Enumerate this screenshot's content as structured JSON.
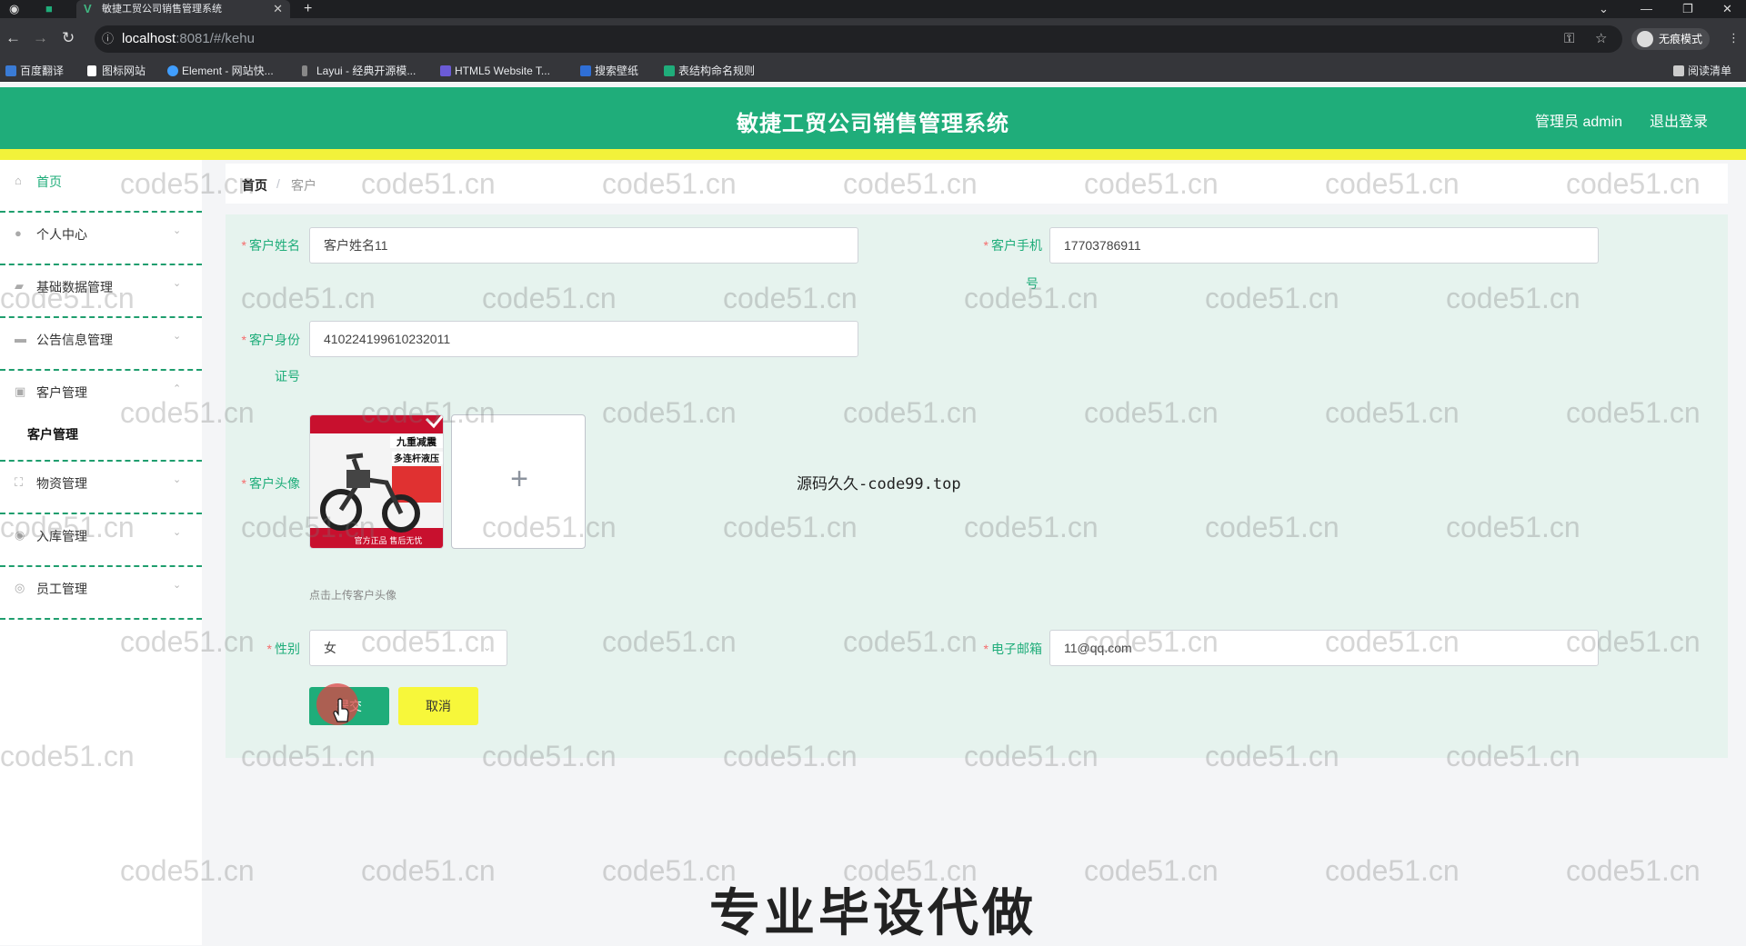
{
  "browser": {
    "tab_title": "敏捷工贸公司销售管理系统",
    "url_host": "localhost",
    "url_path": ":8081/#/kehu",
    "incognito_label": "无痕模式",
    "reading_list_label": "阅读清单",
    "bookmarks": [
      "百度翻译",
      "图标网站",
      "Element - 网站快...",
      "Layui - 经典开源模...",
      "HTML5 Website T...",
      "搜索壁纸",
      "表结构命名规则"
    ]
  },
  "header": {
    "title": "敏捷工贸公司销售管理系统",
    "admin_label": "管理员 admin",
    "logout_label": "退出登录"
  },
  "sidebar": {
    "items": [
      {
        "label": "首页"
      },
      {
        "label": "个人中心"
      },
      {
        "label": "基础数据管理"
      },
      {
        "label": "公告信息管理"
      },
      {
        "label": "客户管理"
      },
      {
        "label": "物资管理"
      },
      {
        "label": "入库管理"
      },
      {
        "label": "员工管理"
      }
    ],
    "submenu_label": "客户管理"
  },
  "breadcrumb": {
    "home": "首页",
    "separator": "/",
    "current": "客户"
  },
  "form": {
    "name_label": "客户姓名",
    "name_value": "客户姓名11",
    "phone_label_1": "客户手机",
    "phone_label_2": "号",
    "phone_value": "17703786911",
    "id_label_1": "客户身份",
    "id_label_2": "证号",
    "id_value": "410224199610232011",
    "avatar_label": "客户头像",
    "avatar_add": "+",
    "avatar_tip": "点击上传客户头像",
    "gender_label": "性别",
    "gender_value": "女",
    "email_label": "电子邮箱",
    "email_value": "11@qq.com",
    "submit_label": "提交",
    "cancel_label": "取消"
  },
  "avatar_image_text": {
    "line1": "九重减震",
    "line2": "多连杆液压",
    "line3": "官方正品 售后无忧"
  },
  "promo": {
    "center_text": "源码久久-code99.top",
    "bottom_text": "专业毕设代做"
  },
  "watermark": "code51.cn",
  "colors": {
    "header_green": "#1fad7a",
    "accent_yellow": "#f2f23a",
    "required_red": "#f56c6c"
  }
}
